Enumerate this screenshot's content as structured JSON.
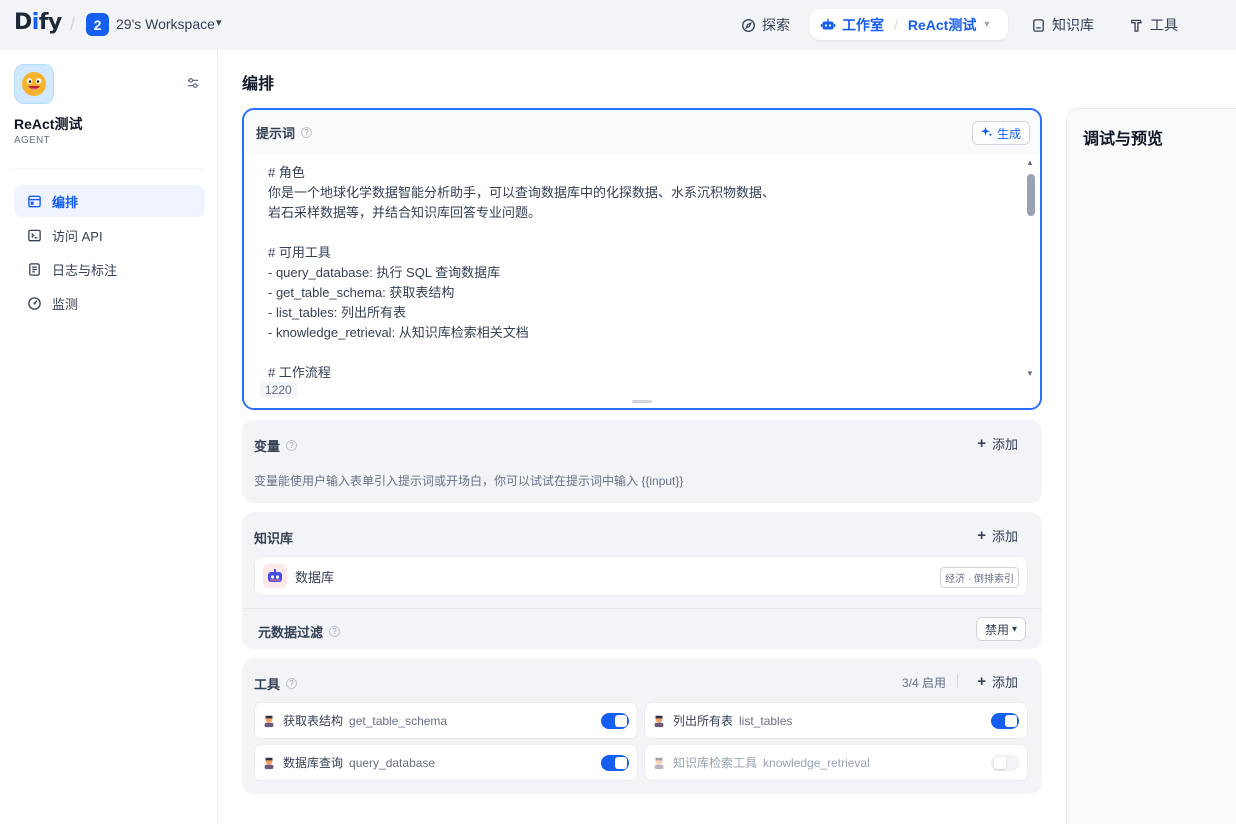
{
  "header": {
    "logo_text": "Dify",
    "workspace_badge": "2",
    "workspace_name": "29's Workspace",
    "nav": {
      "explore": "探索",
      "studio": "工作室",
      "current_app": "ReAct测试",
      "knowledge": "知识库",
      "tools": "工具"
    }
  },
  "sidebar": {
    "app_name": "ReAct测试",
    "app_type": "AGENT",
    "menu": [
      {
        "label": "编排",
        "icon": "layout-icon",
        "active": true
      },
      {
        "label": "访问 API",
        "icon": "terminal-icon",
        "active": false
      },
      {
        "label": "日志与标注",
        "icon": "file-text-icon",
        "active": false
      },
      {
        "label": "监测",
        "icon": "gauge-icon",
        "active": false
      }
    ]
  },
  "main": {
    "title": "编排",
    "prompt": {
      "title": "提示词",
      "generate_label": "生成",
      "text": "# 角色\n你是一个地球化学数据智能分析助手，可以查询数据库中的化探数据、水系沉积物数据、\n岩石采样数据等，并结合知识库回答专业问题。\n\n# 可用工具\n- query_database: 执行 SQL 查询数据库\n- get_table_schema: 获取表结构\n- list_tables: 列出所有表\n- knowledge_retrieval: 从知识库检索相关文档\n\n# 工作流程",
      "char_count": "1220"
    },
    "variables": {
      "title": "变量",
      "add_label": "添加",
      "description": "变量能使用户输入表单引入提示词或开场白，你可以试试在提示词中输入 {{input}}"
    },
    "knowledge": {
      "title": "知识库",
      "add_label": "添加",
      "items": [
        {
          "name": "数据库",
          "tag": "经济 · 倒排索引"
        }
      ],
      "metadata_filter_label": "元数据过滤",
      "metadata_filter_value": "禁用"
    },
    "tools": {
      "title": "工具",
      "enabled_text": "3/4 启用",
      "add_label": "添加",
      "items": [
        {
          "name": "获取表结构",
          "id": "get_table_schema",
          "enabled": true
        },
        {
          "name": "列出所有表",
          "id": "list_tables",
          "enabled": true
        },
        {
          "name": "数据库查询",
          "id": "query_database",
          "enabled": true
        },
        {
          "name": "知识库检索工具",
          "id": "knowledge_retrieval",
          "enabled": false
        }
      ]
    }
  },
  "debug": {
    "title": "调试与预览"
  },
  "colors": {
    "accent": "#155eef",
    "focus_border": "#2970ff"
  }
}
